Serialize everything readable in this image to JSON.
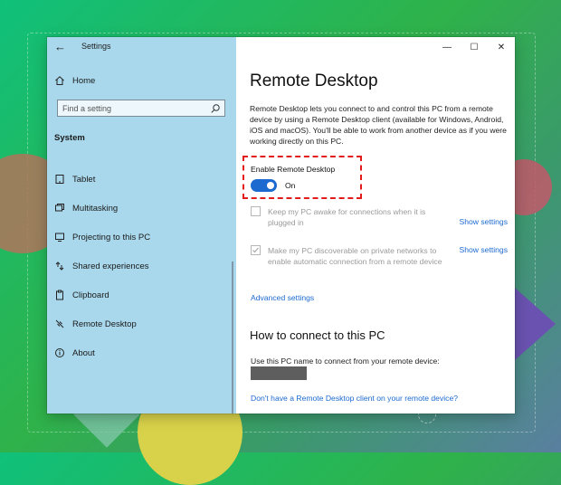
{
  "window": {
    "title": "Settings",
    "minimize_icon": "—",
    "maximize_icon": "☐",
    "close_icon": "✕",
    "back_icon": "←"
  },
  "sidebar": {
    "home_label": "Home",
    "search_placeholder": "Find a setting",
    "section_title": "System",
    "items": [
      {
        "label": "Tablet",
        "icon": "tablet-icon"
      },
      {
        "label": "Multitasking",
        "icon": "multitasking-icon"
      },
      {
        "label": "Projecting to this PC",
        "icon": "projecting-icon"
      },
      {
        "label": "Shared experiences",
        "icon": "shared-experiences-icon"
      },
      {
        "label": "Clipboard",
        "icon": "clipboard-icon"
      },
      {
        "label": "Remote Desktop",
        "icon": "remote-desktop-icon"
      },
      {
        "label": "About",
        "icon": "info-icon"
      }
    ]
  },
  "main": {
    "title": "Remote Desktop",
    "description": "Remote Desktop lets you connect to and control this PC from a remote device by using a Remote Desktop client (available for Windows, Android, iOS and macOS). You'll be able to work from another device as if you were working directly on this PC.",
    "enable_label": "Enable Remote Desktop",
    "toggle_state": "On",
    "toggle_on": true,
    "check1_text": "Keep my PC awake for connections when it is plugged in",
    "check1_checked": false,
    "check2_text": "Make my PC discoverable on private networks to enable automatic connection from a remote device",
    "check2_checked": true,
    "show_settings_label": "Show settings",
    "advanced_settings": "Advanced settings",
    "how_to_title": "How to connect to this PC",
    "pc_name_label": "Use this PC name to connect from your remote device:",
    "client_link": "Don't have a Remote Desktop client on your remote device?"
  },
  "colors": {
    "accent": "#1c6ad0",
    "sidebar_bg": "#a9d8ec",
    "highlight": "#e21b1b"
  }
}
